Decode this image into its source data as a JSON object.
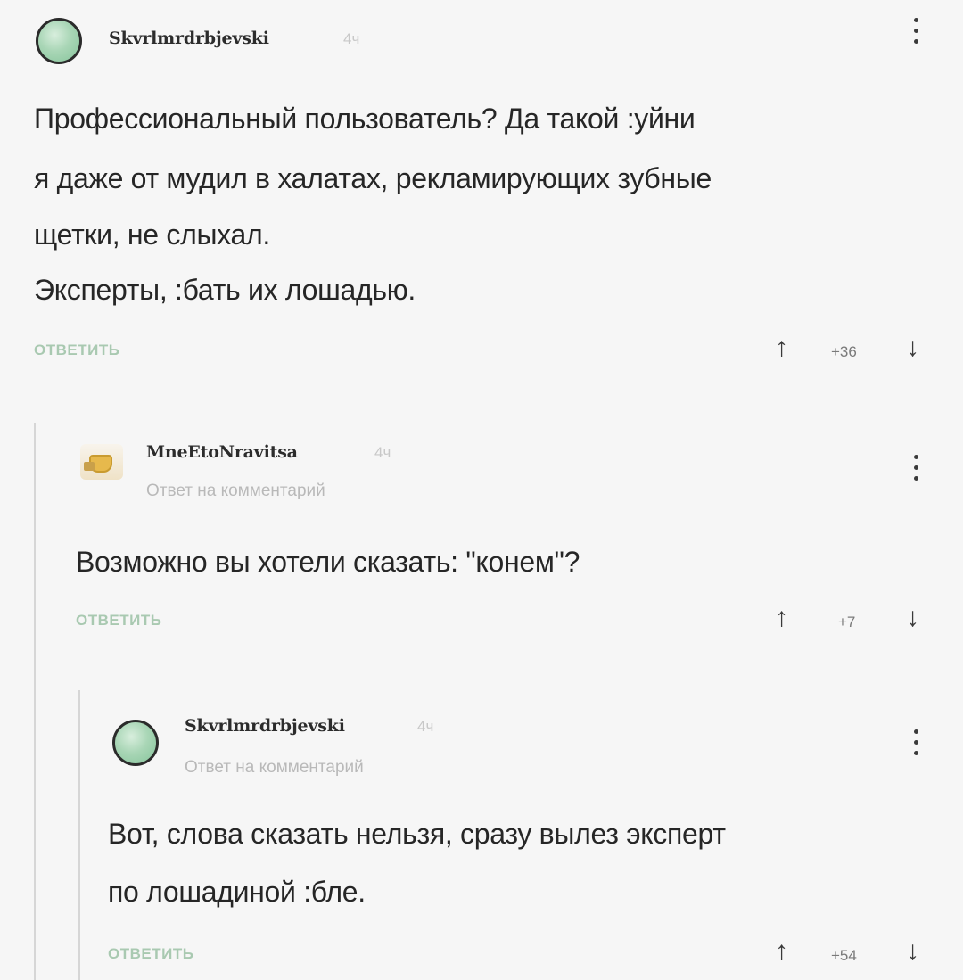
{
  "comments": [
    {
      "username": "Skvrlmrdrbjevski",
      "time": "4ч",
      "lines": [
        "Профессиональный пользователь? Да такой :уйни",
        "я даже от мудил в халатах, рекламирующих зубные",
        "щетки, не слыхал.",
        "Эксперты, :бать их лошадью."
      ],
      "reply_label": "ОТВЕТИТЬ",
      "score": "+36",
      "upvote_icon": "↑",
      "downvote_icon": "↓"
    },
    {
      "username": "MneEtoNravitsa",
      "time": "4ч",
      "reply_to": "Ответ на комментарий",
      "lines": [
        "Возможно вы хотели сказать: \"конем\"?"
      ],
      "reply_label": "ОТВЕТИТЬ",
      "score": "+7",
      "upvote_icon": "↑",
      "downvote_icon": "↓"
    },
    {
      "username": "Skvrlmrdrbjevski",
      "time": "4ч",
      "reply_to": "Ответ на комментарий",
      "lines": [
        "Вот, слова сказать нельзя, сразу вылез эксперт",
        "по лошадиной :бле."
      ],
      "reply_label": "ОТВЕТИТЬ",
      "score": "+54",
      "upvote_icon": "↑",
      "downvote_icon": "↓"
    }
  ]
}
